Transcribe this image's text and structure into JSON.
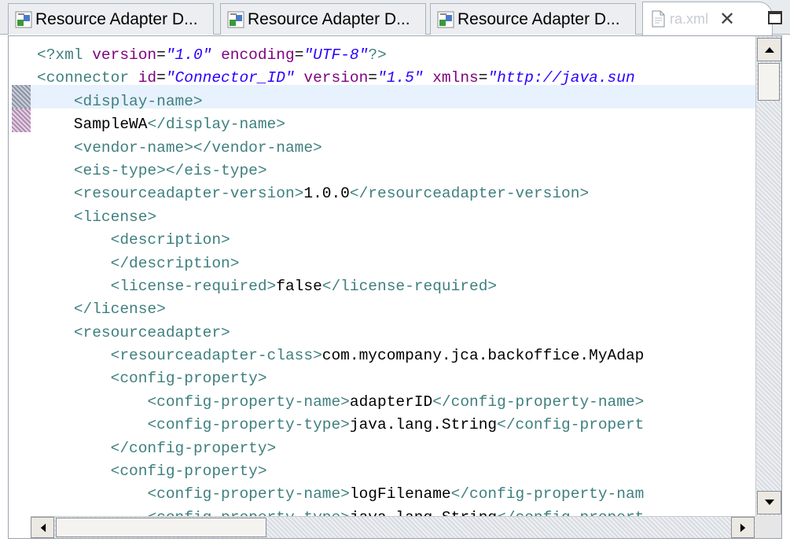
{
  "tabs": [
    {
      "label": "Resource Adapter D...",
      "icon": "resource-adapter-icon"
    },
    {
      "label": "Resource Adapter D...",
      "icon": "resource-adapter-icon"
    },
    {
      "label": "Resource Adapter D...",
      "icon": "resource-adapter-icon"
    },
    {
      "label": "ra.xml",
      "icon": "xml-file-icon",
      "close": "✕",
      "active": true
    }
  ],
  "code_lines": [
    [
      {
        "c": "pi",
        "t": "<?xml "
      },
      {
        "c": "a",
        "t": "version"
      },
      {
        "c": "x",
        "t": "="
      },
      {
        "c": "v",
        "t": "\"1.0\""
      },
      {
        "c": "x",
        "t": " "
      },
      {
        "c": "a",
        "t": "encoding"
      },
      {
        "c": "x",
        "t": "="
      },
      {
        "c": "v",
        "t": "\"UTF-8\""
      },
      {
        "c": "pi",
        "t": "?>"
      }
    ],
    [
      {
        "c": "t",
        "t": "<connector "
      },
      {
        "c": "a",
        "t": "id"
      },
      {
        "c": "x",
        "t": "="
      },
      {
        "c": "v",
        "t": "\"Connector_ID\""
      },
      {
        "c": "x",
        "t": " "
      },
      {
        "c": "a",
        "t": "version"
      },
      {
        "c": "x",
        "t": "="
      },
      {
        "c": "v",
        "t": "\"1.5\""
      },
      {
        "c": "x",
        "t": " "
      },
      {
        "c": "a",
        "t": "xmlns"
      },
      {
        "c": "x",
        "t": "="
      },
      {
        "c": "v",
        "t": "\"http://java.sun"
      }
    ],
    [
      {
        "c": "x",
        "t": "    "
      },
      {
        "c": "t",
        "t": "<display-name>"
      }
    ],
    [
      {
        "c": "x",
        "t": "    SampleWA"
      },
      {
        "c": "t",
        "t": "</display-name>"
      }
    ],
    [
      {
        "c": "x",
        "t": "    "
      },
      {
        "c": "t",
        "t": "<vendor-name></vendor-name>"
      }
    ],
    [
      {
        "c": "x",
        "t": "    "
      },
      {
        "c": "t",
        "t": "<eis-type></eis-type>"
      }
    ],
    [
      {
        "c": "x",
        "t": "    "
      },
      {
        "c": "t",
        "t": "<resourceadapter-version>"
      },
      {
        "c": "x",
        "t": "1.0.0"
      },
      {
        "c": "t",
        "t": "</resourceadapter-version>"
      }
    ],
    [
      {
        "c": "x",
        "t": "    "
      },
      {
        "c": "t",
        "t": "<license>"
      }
    ],
    [
      {
        "c": "x",
        "t": "        "
      },
      {
        "c": "t",
        "t": "<description>"
      }
    ],
    [
      {
        "c": "x",
        "t": "        "
      },
      {
        "c": "t",
        "t": "</description>"
      }
    ],
    [
      {
        "c": "x",
        "t": "        "
      },
      {
        "c": "t",
        "t": "<license-required>"
      },
      {
        "c": "x",
        "t": "false"
      },
      {
        "c": "t",
        "t": "</license-required>"
      }
    ],
    [
      {
        "c": "x",
        "t": "    "
      },
      {
        "c": "t",
        "t": "</license>"
      }
    ],
    [
      {
        "c": "x",
        "t": "    "
      },
      {
        "c": "t",
        "t": "<resourceadapter>"
      }
    ],
    [
      {
        "c": "x",
        "t": "        "
      },
      {
        "c": "t",
        "t": "<resourceadapter-class>"
      },
      {
        "c": "x",
        "t": "com.mycompany.jca.backoffice.MyAdap"
      }
    ],
    [
      {
        "c": "x",
        "t": "        "
      },
      {
        "c": "t",
        "t": "<config-property>"
      }
    ],
    [
      {
        "c": "x",
        "t": "            "
      },
      {
        "c": "t",
        "t": "<config-property-name>"
      },
      {
        "c": "x",
        "t": "adapterID"
      },
      {
        "c": "t",
        "t": "</config-property-name>"
      }
    ],
    [
      {
        "c": "x",
        "t": "            "
      },
      {
        "c": "t",
        "t": "<config-property-type>"
      },
      {
        "c": "x",
        "t": "java.lang.String"
      },
      {
        "c": "t",
        "t": "</config-propert"
      }
    ],
    [
      {
        "c": "x",
        "t": "        "
      },
      {
        "c": "t",
        "t": "</config-property>"
      }
    ],
    [
      {
        "c": "x",
        "t": "        "
      },
      {
        "c": "t",
        "t": "<config-property>"
      }
    ],
    [
      {
        "c": "x",
        "t": "            "
      },
      {
        "c": "t",
        "t": "<config-property-name>"
      },
      {
        "c": "x",
        "t": "logFilename"
      },
      {
        "c": "t",
        "t": "</config-property-nam"
      }
    ],
    [
      {
        "c": "x",
        "t": "            "
      },
      {
        "c": "t",
        "t": "<config-property-type>"
      },
      {
        "c": "x",
        "t": "java.lang.String"
      },
      {
        "c": "t",
        "t": "</config-propert"
      }
    ]
  ],
  "colors": {
    "tag": "#3f7f7f",
    "attribute": "#7f007f",
    "value": "#2a00ff",
    "text": "#000000",
    "current_line": "#e8f2fe"
  }
}
